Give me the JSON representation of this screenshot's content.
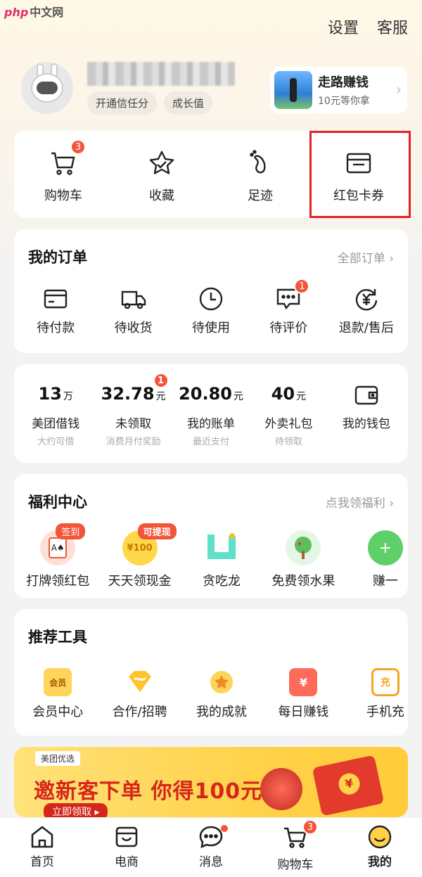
{
  "watermark": {
    "brand": "php",
    "site": "中文网"
  },
  "topbar": {
    "settings": "设置",
    "service": "客服"
  },
  "profile": {
    "tag1": "开通信任分",
    "tag2": "成长值"
  },
  "walk": {
    "title": "走路赚钱",
    "subtitle": "10元等你拿"
  },
  "quick": [
    {
      "label": "购物车",
      "badge": "3"
    },
    {
      "label": "收藏"
    },
    {
      "label": "足迹"
    },
    {
      "label": "红包卡券"
    }
  ],
  "orders": {
    "title": "我的订单",
    "all": "全部订单 ›",
    "items": [
      {
        "label": "待付款"
      },
      {
        "label": "待收货"
      },
      {
        "label": "待使用"
      },
      {
        "label": "待评价",
        "badge": "1"
      },
      {
        "label": "退款/售后"
      }
    ]
  },
  "finance": [
    {
      "value": "13",
      "unit": "万",
      "label": "美团借钱",
      "sub": "大约可借"
    },
    {
      "value": "32.78",
      "unit": "元",
      "label": "未领取",
      "sub": "消费月付奖励",
      "badge": "1"
    },
    {
      "value": "20.80",
      "unit": "元",
      "label": "我的账单",
      "sub": "最近支付"
    },
    {
      "value": "40",
      "unit": "元",
      "label": "外卖礼包",
      "sub": "待领取"
    },
    {
      "label": "我的钱包"
    }
  ],
  "welfare": {
    "title": "福利中心",
    "link": "点我领福利 ›",
    "items": [
      {
        "label": "打牌领红包",
        "badge": "签到"
      },
      {
        "label": "天天领现金",
        "badge": "可提现",
        "coin": "¥100"
      },
      {
        "label": "贪吃龙"
      },
      {
        "label": "免费领水果"
      },
      {
        "label": "赚一"
      }
    ]
  },
  "tools": {
    "title": "推荐工具",
    "items": [
      {
        "label": "会员中心",
        "icon_text": "会员"
      },
      {
        "label": "合作/招聘"
      },
      {
        "label": "我的成就"
      },
      {
        "label": "每日赚钱",
        "icon_text": "¥"
      },
      {
        "label": "手机充",
        "icon_text": "充"
      }
    ]
  },
  "banner": {
    "brand": "美团优选",
    "main": "邀新客下单 你得100元",
    "button": "立即领取 ▸"
  },
  "tabbar": [
    {
      "label": "首页"
    },
    {
      "label": "电商"
    },
    {
      "label": "消息"
    },
    {
      "label": "购物车",
      "badge": "3"
    },
    {
      "label": "我的",
      "active": true
    }
  ],
  "colors": {
    "accent": "#f2563a",
    "highlight": "#e02424",
    "brand_yellow": "#ffd24a"
  }
}
